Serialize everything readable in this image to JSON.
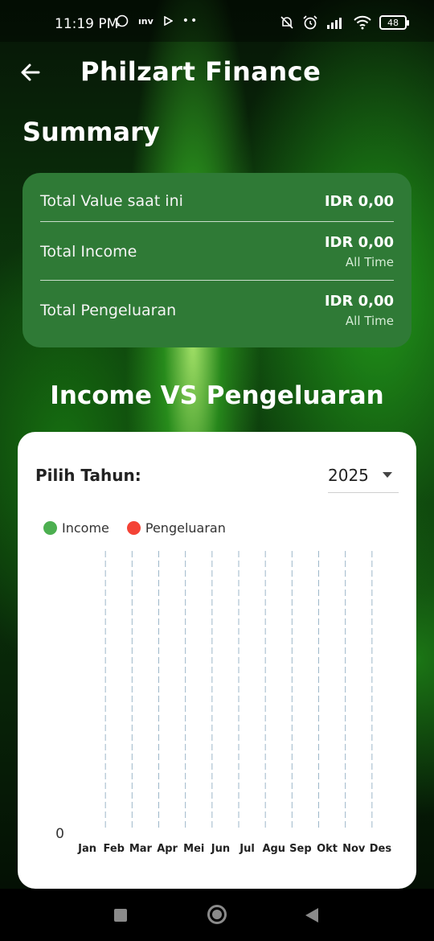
{
  "status_bar": {
    "time": "11:19 PM",
    "left_icons": [
      "whatsapp-icon",
      "inv-icon",
      "play-icon",
      "more-dots-icon"
    ],
    "right_icons": [
      "mute-bell-icon",
      "alarm-icon",
      "signal-icon",
      "wifi-icon"
    ],
    "battery": "48"
  },
  "appbar": {
    "title": "Philzart Finance"
  },
  "summary": {
    "title": "Summary",
    "rows": [
      {
        "label": "Total Value saat ini",
        "value": "IDR 0,00"
      },
      {
        "label": "Total Income",
        "value": "IDR 0,00",
        "sub": "All Time"
      },
      {
        "label": "Total Pengeluaran",
        "value": "IDR 0,00",
        "sub": "All Time"
      }
    ]
  },
  "chart_section": {
    "heading": "Income VS Pengeluaran",
    "year_label": "Pilih Tahun:",
    "year_value": "2025"
  },
  "colors": {
    "card_green": "#2f7a36",
    "income": "#4caf50",
    "expense": "#f44336",
    "grid": "#9db7c9"
  },
  "chart_data": {
    "type": "bar",
    "categories": [
      "Jan",
      "Feb",
      "Mar",
      "Apr",
      "Mei",
      "Jun",
      "Jul",
      "Agu",
      "Sep",
      "Okt",
      "Nov",
      "Des"
    ],
    "series": [
      {
        "name": "Income",
        "values": [
          0,
          0,
          0,
          0,
          0,
          0,
          0,
          0,
          0,
          0,
          0,
          0
        ],
        "color": "#4caf50"
      },
      {
        "name": "Pengeluaran",
        "values": [
          0,
          0,
          0,
          0,
          0,
          0,
          0,
          0,
          0,
          0,
          0,
          0
        ],
        "color": "#f44336"
      }
    ],
    "y_ticks": [
      "0"
    ],
    "ylim": [
      0,
      0
    ],
    "grid": "vertical dashed",
    "legend": "top-left"
  }
}
